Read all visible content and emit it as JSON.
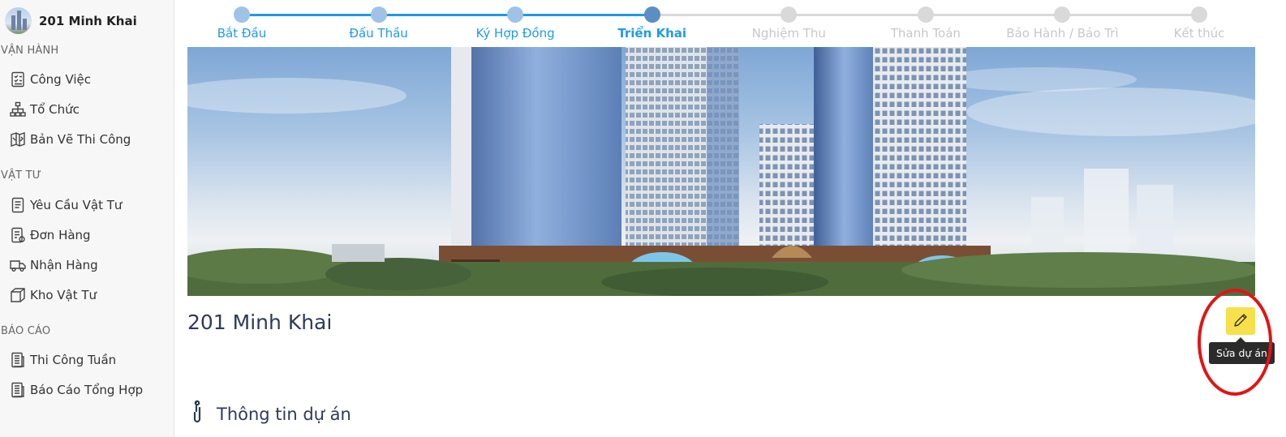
{
  "project": {
    "name": "201 Minh Khai",
    "title": "201 Minh Khai"
  },
  "sidebar": {
    "sections": [
      {
        "title": "VẬN HÀNH",
        "items": [
          {
            "label": "Công Việc",
            "icon": "task-list-icon"
          },
          {
            "label": "Tổ Chức",
            "icon": "org-chart-icon"
          },
          {
            "label": "Bản Vẽ Thi Công",
            "icon": "blueprint-icon"
          }
        ]
      },
      {
        "title": "VẬT TƯ",
        "items": [
          {
            "label": "Yêu Cầu Vật Tư",
            "icon": "document-icon"
          },
          {
            "label": "Đơn Hàng",
            "icon": "order-icon"
          },
          {
            "label": "Nhận Hàng",
            "icon": "truck-icon"
          },
          {
            "label": "Kho Vật Tư",
            "icon": "box-icon"
          }
        ]
      },
      {
        "title": "BÁO CÁO",
        "items": [
          {
            "label": "Thi Công Tuần",
            "icon": "report-icon"
          },
          {
            "label": "Báo Cáo Tổng Hợp",
            "icon": "summary-report-icon"
          }
        ]
      }
    ]
  },
  "stepper": {
    "steps": [
      {
        "label": "Bắt Đầu",
        "state": "done"
      },
      {
        "label": "Đấu Thầu",
        "state": "done"
      },
      {
        "label": "Ký Hợp Đồng",
        "state": "done"
      },
      {
        "label": "Triển Khai",
        "state": "active"
      },
      {
        "label": "Nghiệm Thu",
        "state": "pending"
      },
      {
        "label": "Thanh Toán",
        "state": "pending"
      },
      {
        "label": "Bảo Hành / Bảo Trì",
        "state": "pending"
      },
      {
        "label": "Kết thúc",
        "state": "pending"
      }
    ]
  },
  "actions": {
    "edit_tooltip": "Sửa dự án"
  },
  "info_section": {
    "title": "Thông tin dự án"
  },
  "colors": {
    "accent": "#1e9be8",
    "step_done_dot": "#9ec3e6",
    "step_active_dot": "#5b8ec4",
    "step_pending": "#d9d9d9",
    "edit_button": "#f7e04a",
    "highlight_ring": "#e01515"
  }
}
